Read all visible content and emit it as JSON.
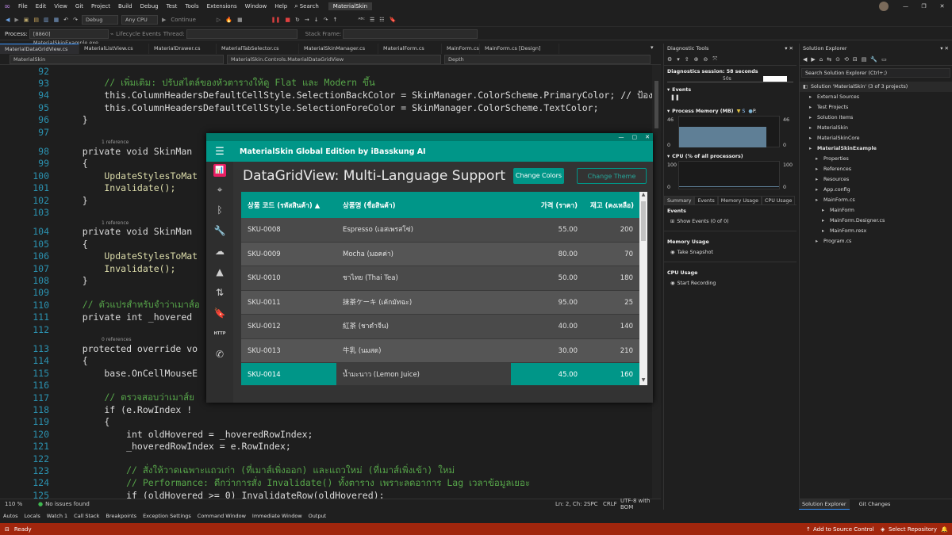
{
  "menubar": {
    "items": [
      "File",
      "Edit",
      "View",
      "Git",
      "Project",
      "Build",
      "Debug",
      "Test",
      "Tools",
      "Extensions",
      "Window",
      "Help"
    ],
    "search": "Search",
    "title_badge": "MaterialSkin"
  },
  "toolbar": {
    "config": "Debug",
    "platform": "Any CPU",
    "continue": "Continue"
  },
  "toolbar2": {
    "process_label": "Process:",
    "process_value": "[8860] MaterialSkinExample.exe",
    "lifecycle": "Lifecycle Events",
    "thread": "Thread:",
    "stack": "Stack Frame:"
  },
  "tabs": [
    "MaterialDataGridView.cs",
    "MaterialListView.cs",
    "MaterialDrawer.cs",
    "MaterialTabSelector.cs",
    "MaterialSkinManager.cs",
    "MaterialForm.cs",
    "MainForm.cs",
    "MainForm.cs [Design]"
  ],
  "nav": {
    "project": "MaterialSkin",
    "class": "MaterialSkin.Controls.MaterialDataGridView",
    "member": "Depth"
  },
  "code_lines": [
    {
      "n": "92",
      "html": "",
      "t": ""
    },
    {
      "n": "93",
      "t": "        // เพิ่มเติม: ปรับสไตล์ของหัวตารางให้ดู Flat และ Modern ขึ้น",
      "c": "cm"
    },
    {
      "n": "94",
      "t": "        this.ColumnHeadersDefaultCellStyle.SelectionBackColor = SkinManager.ColorScheme.PrimaryColor; // ป้องกั",
      "c": "mix"
    },
    {
      "n": "95",
      "t": "        this.ColumnHeadersDefaultCellStyle.SelectionForeColor = SkinManager.ColorScheme.TextColor;",
      "c": "mix"
    },
    {
      "n": "96",
      "t": "    }",
      "c": ""
    },
    {
      "n": "97",
      "t": "",
      "c": ""
    },
    {
      "n": "98",
      "t": "    private void SkinMan",
      "c": "decl",
      "ref": "1 reference"
    },
    {
      "n": "99",
      "t": "    {",
      "c": ""
    },
    {
      "n": "100",
      "t": "        UpdateStylesToMat",
      "c": "mt"
    },
    {
      "n": "101",
      "t": "        Invalidate();",
      "c": "mt"
    },
    {
      "n": "102",
      "t": "    }",
      "c": ""
    },
    {
      "n": "103",
      "t": "",
      "c": ""
    },
    {
      "n": "104",
      "t": "    private void SkinMan",
      "c": "decl",
      "ref": "1 reference"
    },
    {
      "n": "105",
      "t": "    {",
      "c": ""
    },
    {
      "n": "106",
      "t": "        UpdateStylesToMat",
      "c": "mt"
    },
    {
      "n": "107",
      "t": "        Invalidate();",
      "c": "mt"
    },
    {
      "n": "108",
      "t": "    }",
      "c": ""
    },
    {
      "n": "109",
      "t": "",
      "c": ""
    },
    {
      "n": "110",
      "t": "    // ตัวแปรสำหรับจำว่าเมาส์อ",
      "c": "cm"
    },
    {
      "n": "111",
      "t": "    private int _hovered",
      "c": "decl2"
    },
    {
      "n": "112",
      "t": "",
      "c": ""
    },
    {
      "n": "113",
      "t": "    protected override vo",
      "c": "decl3",
      "ref": "0 references"
    },
    {
      "n": "114",
      "t": "    {",
      "c": ""
    },
    {
      "n": "115",
      "t": "        base.OnCellMouseE",
      "c": "base"
    },
    {
      "n": "116",
      "t": "",
      "c": ""
    },
    {
      "n": "117",
      "t": "        // ตรวจสอบว่าเมาส์ย",
      "c": "cm"
    },
    {
      "n": "118",
      "t": "        if (e.RowIndex !",
      "c": "if"
    },
    {
      "n": "119",
      "t": "        {",
      "c": ""
    },
    {
      "n": "120",
      "t": "            int oldHovered = _hoveredRowIndex;",
      "c": "int"
    },
    {
      "n": "121",
      "t": "            _hoveredRowIndex = e.RowIndex;",
      "c": "id"
    },
    {
      "n": "122",
      "t": "",
      "c": ""
    },
    {
      "n": "123",
      "t": "            // สั่งให้วาดเฉพาะแถวเก่า (ที่เมาส์เพิ่งออก) และแถวใหม่ (ที่เมาส์เพิ่งเข้า) ใหม่",
      "c": "cm"
    },
    {
      "n": "124",
      "t": "            // Performance: ดีกว่าการสั่ง Invalidate() ทั้งตาราง เพราะลดอาการ Lag เวลาข้อมูลเยอะ",
      "c": "cm"
    },
    {
      "n": "125",
      "t": "            if (oldHovered >= 0) InvalidateRow(oldHovered);",
      "c": "if2"
    },
    {
      "n": "126",
      "t": "            InvalidateRow(_hoveredRowIndex);",
      "c": "mt"
    }
  ],
  "editor_status": {
    "zoom": "110 %",
    "issues": "No issues found",
    "pos": "Ln: 2, Ch: 2",
    "spc": "SPC",
    "crlf": "CRLF",
    "enc": "UTF-8 with BOM"
  },
  "app": {
    "title": "MaterialSkin Global Edition by iBasskung AI",
    "heading": "DataGridView: Multi-Language Support",
    "btn_colors": "Change Colors",
    "btn_theme": "Change Theme",
    "columns": [
      "상품 코드 (รหัสสินค้า) ▲",
      "상품명 (ชื่อสินค้า)",
      "가격 (ราคา)",
      "재고 (คงเหลือ)"
    ],
    "rows": [
      [
        "SKU-0008",
        "Espresso (เอสเพรสโซ่)",
        "55.00",
        "200"
      ],
      [
        "SKU-0009",
        "Mocha (มอคค่า)",
        "80.00",
        "70"
      ],
      [
        "SKU-0010",
        "ชาไทย (Thai Tea)",
        "50.00",
        "180"
      ],
      [
        "SKU-0011",
        "抹茶ケーキ (เค้กมัทฉะ)",
        "95.00",
        "25"
      ],
      [
        "SKU-0012",
        "紅茶 (ชาดำจีน)",
        "40.00",
        "140"
      ],
      [
        "SKU-0013",
        "牛乳 (นมสด)",
        "30.00",
        "210"
      ],
      [
        "SKU-0014",
        "น้ำมะนาว (Lemon Juice)",
        "45.00",
        "160"
      ]
    ],
    "rail_http": "HTTP",
    "accent": "#009688"
  },
  "diag": {
    "title": "Diagnostic Tools",
    "session": "Diagnostics session: 58 seconds",
    "tick": "50s",
    "events": "Events",
    "memory": "Process Memory (MB)",
    "mem_val": "46",
    "cpu": "CPU (% of all processors)",
    "cpu_max": "100",
    "cpu_min": "0",
    "mem_min": "0",
    "tabs": [
      "Summary",
      "Events",
      "Memory Usage",
      "CPU Usage"
    ],
    "ev_title": "Events",
    "show_events": "Show Events (0 of 0)",
    "mu_title": "Memory Usage",
    "snapshot": "Take Snapshot",
    "cu_title": "CPU Usage",
    "record": "Start Recording",
    "legend_s": "S",
    "legend_p": "P."
  },
  "solution": {
    "title": "Solution Explorer",
    "search": "Search Solution Explorer (Ctrl+;)",
    "items": [
      {
        "label": "Solution 'MaterialSkin' (3 of 3 projects)",
        "indent": 0
      },
      {
        "label": "External Sources",
        "indent": 1
      },
      {
        "label": "Test Projects",
        "indent": 1
      },
      {
        "label": "Solution Items",
        "indent": 1
      },
      {
        "label": "MaterialSkin",
        "indent": 1
      },
      {
        "label": "MaterialSkinCore",
        "indent": 1
      },
      {
        "label": "MaterialSkinExample",
        "indent": 1
      },
      {
        "label": "Properties",
        "indent": 2
      },
      {
        "label": "References",
        "indent": 2
      },
      {
        "label": "Resources",
        "indent": 2
      },
      {
        "label": "App.config",
        "indent": 2
      },
      {
        "label": "MainForm.cs",
        "indent": 2
      },
      {
        "label": "MainForm",
        "indent": 3
      },
      {
        "label": "MainForm.Designer.cs",
        "indent": 3
      },
      {
        "label": "MainForm.resx",
        "indent": 3
      },
      {
        "label": "Program.cs",
        "indent": 2
      }
    ],
    "tab1": "Solution Explorer",
    "tab2": "Git Changes"
  },
  "bottom_tabs": [
    "Autos",
    "Locals",
    "Watch 1",
    "Call Stack",
    "Breakpoints",
    "Exception Settings",
    "Command Window",
    "Immediate Window",
    "Output"
  ],
  "statusbar": {
    "ready": "Ready",
    "source": "Add to Source Control",
    "repo": "Select Repository"
  }
}
